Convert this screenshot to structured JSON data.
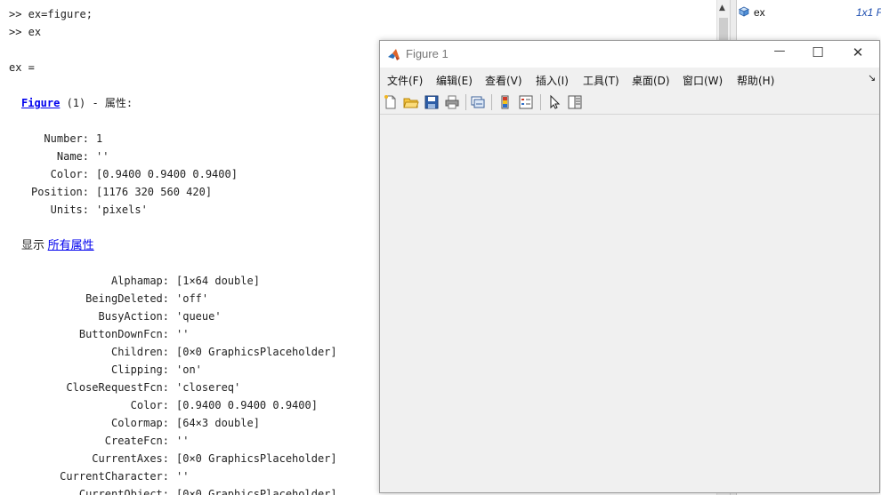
{
  "command_window": {
    "lines": {
      "l1": ">> ex=figure;",
      "l2": ">> ex",
      "l3": "ex =",
      "figure_link": "Figure",
      "figure_rest": " (1) - 属性:",
      "show_label": "显示 ",
      "all_props_link": "所有属性"
    },
    "short_props": [
      {
        "k": "Number:",
        "v": "1"
      },
      {
        "k": "Name:",
        "v": "''"
      },
      {
        "k": "Color:",
        "v": "[0.9400 0.9400 0.9400]"
      },
      {
        "k": "Position:",
        "v": "[1176 320 560 420]"
      },
      {
        "k": "Units:",
        "v": "'pixels'"
      }
    ],
    "all_props": [
      {
        "k": "Alphamap:",
        "v": "[1×64 double]"
      },
      {
        "k": "BeingDeleted:",
        "v": "'off'"
      },
      {
        "k": "BusyAction:",
        "v": "'queue'"
      },
      {
        "k": "ButtonDownFcn:",
        "v": "''"
      },
      {
        "k": "Children:",
        "v": "[0×0 GraphicsPlaceholder]"
      },
      {
        "k": "Clipping:",
        "v": "'on'"
      },
      {
        "k": "CloseRequestFcn:",
        "v": "'closereq'"
      },
      {
        "k": "Color:",
        "v": "[0.9400 0.9400 0.9400]"
      },
      {
        "k": "Colormap:",
        "v": "[64×3 double]"
      },
      {
        "k": "CreateFcn:",
        "v": "''"
      },
      {
        "k": "CurrentAxes:",
        "v": "[0×0 GraphicsPlaceholder]"
      },
      {
        "k": "CurrentCharacter:",
        "v": "''"
      },
      {
        "k": "CurrentObject:",
        "v": "[0×0 GraphicsPlaceholder]"
      }
    ]
  },
  "workspace": {
    "var_name": "ex",
    "var_value": "1x1 F"
  },
  "figure": {
    "title": "Figure 1",
    "menus": [
      "文件(F)",
      "编辑(E)",
      "查看(V)",
      "插入(I)",
      "工具(T)",
      "桌面(D)",
      "窗口(W)",
      "帮助(H)"
    ],
    "dock_glyph": "↘",
    "controls": {
      "minimize": "—",
      "maximize": "☐",
      "close": "✕"
    }
  },
  "colors": {
    "link": "#0000ee",
    "workspace_value": "#1f4fb0",
    "figure_bg": "#f0f0f0"
  }
}
